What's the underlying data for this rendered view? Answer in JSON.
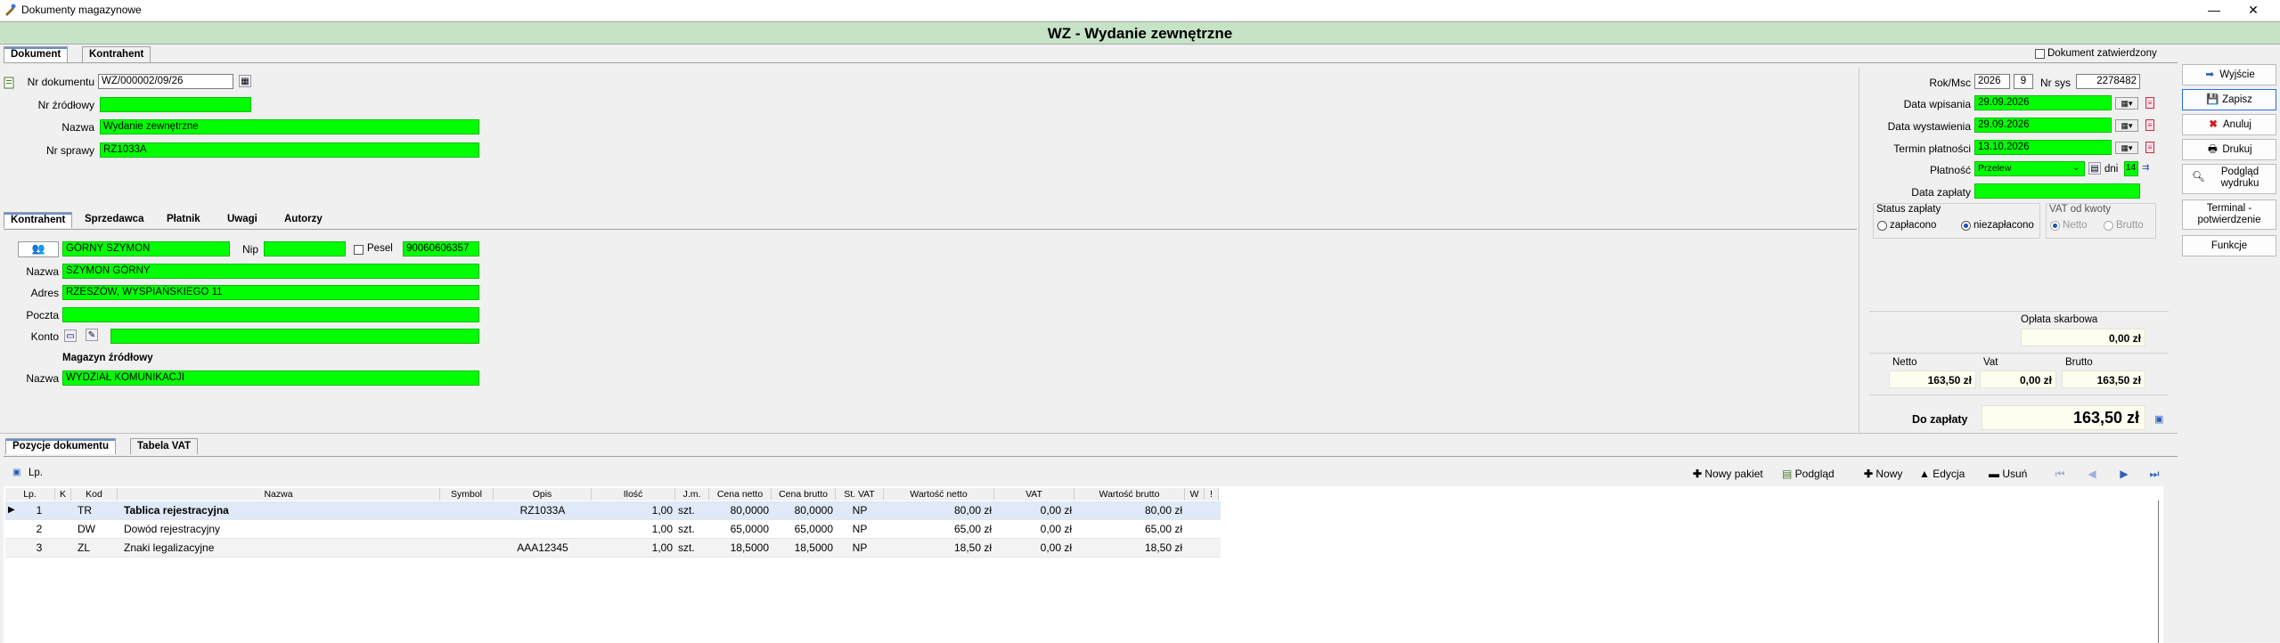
{
  "window": {
    "title": "Dokumenty magazynowe",
    "min": "—",
    "max": "❐",
    "close": "✕"
  },
  "header": {
    "title": "WZ - Wydanie zewnętrzne"
  },
  "tabs_top": [
    "Dokument",
    "Kontrahent"
  ],
  "confirmed": {
    "label": "Dokument zatwierdzony"
  },
  "doc": {
    "nr_label": "Nr dokumentu",
    "nr_value": "WZ/000002/09/26",
    "source_label": "Nr źródłowy",
    "source_value": "",
    "name_label": "Nazwa",
    "name_value": "Wydanie zewnętrzne",
    "case_label": "Nr sprawy",
    "case_value": "RZ1033A"
  },
  "tabs_mid": [
    "Kontrahent",
    "Sprzedawca",
    "Płatnik",
    "Uwagi",
    "Autorzy"
  ],
  "contractor": {
    "code_value": "GÓRNY SZYMON",
    "nip_label": "Nip",
    "nip_value": "",
    "pesel_label": "Pesel",
    "pesel_value": "90060606357",
    "name_label": "Nazwa",
    "name_value": "SZYMON GÓRNY",
    "address_label": "Adres",
    "address_value": "RZESZÓW, WYSPIAŃSKIEGO  11",
    "post_label": "Poczta",
    "post_value": "",
    "account_label": "Konto",
    "account_value": "",
    "warehouse_title": "Magazyn źródłowy",
    "warehouse_label": "Nazwa",
    "warehouse_value": "WYDZIAŁ KOMUNIKACJI"
  },
  "right": {
    "year_label": "Rok/Msc",
    "year_value": "2026",
    "month_value": "9",
    "sys_label": "Nr sys",
    "sys_value": "2278482",
    "entry_label": "Data wpisania",
    "entry_value": "29.09.2026",
    "issue_label": "Data wystawienia",
    "issue_value": "29.09.2026",
    "due_label": "Termin płatności",
    "due_value": "13.10.2026",
    "payment_label": "Płatność",
    "payment_value": "Przelew",
    "days_label": "dni",
    "days_value": "14",
    "paid_date_label": "Data zapłaty",
    "paid_date_value": "",
    "status_title": "Status zapłaty",
    "status_paid": "zapłacono",
    "status_unpaid": "niezapłacono",
    "vat_title": "VAT od kwoty",
    "vat_net": "Netto",
    "vat_gross": "Brutto",
    "fee_label": "Opłata skarbowa",
    "fee_value": "0,00 zł",
    "netto_label": "Netto",
    "netto_value": "163,50 zł",
    "vat_label": "Vat",
    "vat_value": "0,00 zł",
    "brutto_label": "Brutto",
    "brutto_value": "163,50 zł",
    "pay_label": "Do zapłaty",
    "pay_value": "163,50 zł"
  },
  "actions": {
    "exit": "Wyjście",
    "save": "Zapisz",
    "cancel": "Anuluj",
    "print": "Drukuj",
    "preview1": "Podgląd",
    "preview2": "wydruku",
    "terminal1": "Terminal -",
    "terminal2": "potwierdzenie",
    "functions": "Funkcje"
  },
  "tabs_bottom": [
    "Pozycje dokumentu",
    "Tabela VAT"
  ],
  "grid_toolbar": {
    "lp": "Lp.",
    "new_package": "Nowy pakiet",
    "preview": "Podgląd",
    "new": "Nowy",
    "edit": "Edycja",
    "delete": "Usuń"
  },
  "grid": {
    "columns": [
      "Lp.",
      "K",
      "Kod",
      "Nazwa",
      "Symbol",
      "Opis",
      "Ilość",
      "J.m.",
      "Cena netto",
      "Cena brutto",
      "St. VAT",
      "Wartość netto",
      "VAT",
      "Wartość brutto",
      "W",
      "!"
    ],
    "rows": [
      {
        "lp": "1",
        "k": "",
        "kod": "TR",
        "nazwa": "Tablica rejestracyjna",
        "symbol": "",
        "opis": "RZ1033A",
        "ilosc": "1,00",
        "jm": "szt.",
        "cn": "80,0000",
        "cb": "80,0000",
        "st": "NP",
        "wn": "80,00 zł",
        "vat": "0,00 zł",
        "wb": "80,00 zł"
      },
      {
        "lp": "2",
        "k": "",
        "kod": "DW",
        "nazwa": "Dowód rejestracyjny",
        "symbol": "",
        "opis": "",
        "ilosc": "1,00",
        "jm": "szt.",
        "cn": "65,0000",
        "cb": "65,0000",
        "st": "NP",
        "wn": "65,00 zł",
        "vat": "0,00 zł",
        "wb": "65,00 zł"
      },
      {
        "lp": "3",
        "k": "",
        "kod": "ZL",
        "nazwa": "Znaki legalizacyjne",
        "symbol": "",
        "opis": "AAA12345",
        "ilosc": "1,00",
        "jm": "szt.",
        "cn": "18,5000",
        "cb": "18,5000",
        "st": "NP",
        "wn": "18,50 zł",
        "vat": "0,00 zł",
        "wb": "18,50 zł"
      }
    ]
  }
}
